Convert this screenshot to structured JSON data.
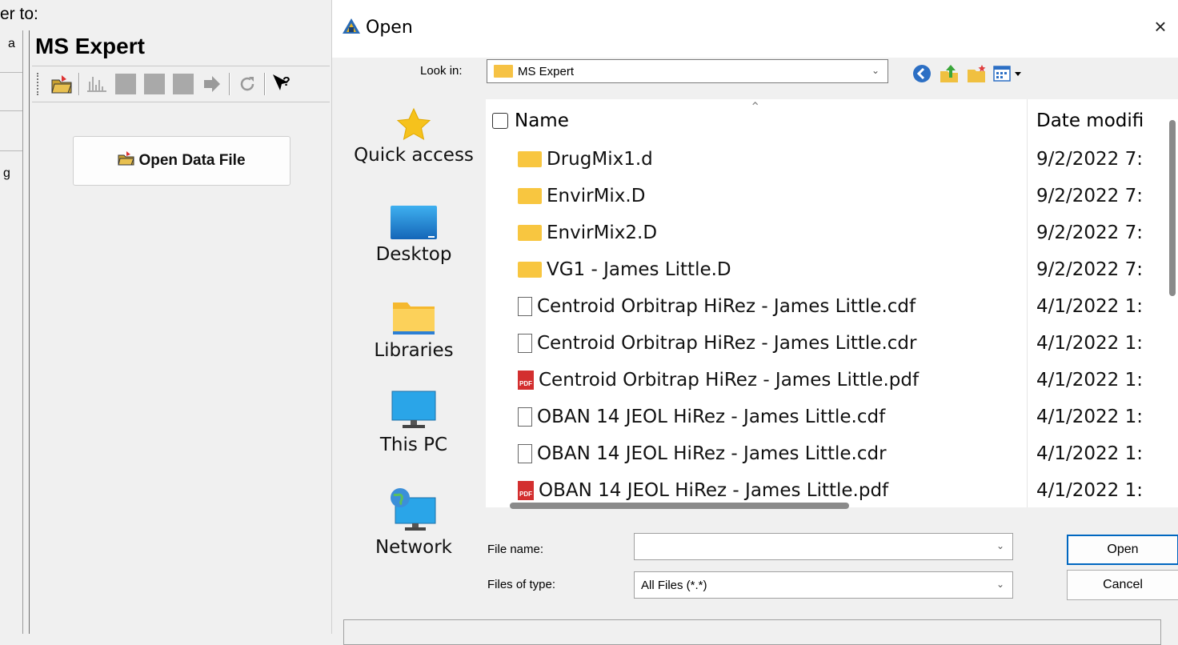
{
  "background_app": {
    "top_text": "er to:",
    "title": "MS Expert",
    "left_strip_chars": [
      "a",
      "g"
    ],
    "open_data_label": "Open Data File",
    "toolbar_icons": [
      "open-folder-icon",
      "spectrum-icon",
      "gray-square-icon",
      "gray-square-icon",
      "arrow-right-icon",
      "refresh-icon",
      "help-pointer-icon"
    ]
  },
  "dialog": {
    "title": "Open",
    "close_glyph": "×",
    "look_in_label": "Look in:",
    "look_in_value": "MS Expert",
    "nav_icons": [
      "back-icon",
      "up-folder-icon",
      "new-folder-icon",
      "view-menu-icon"
    ],
    "places": [
      {
        "label": "Quick access",
        "icon": "star-icon"
      },
      {
        "label": "Desktop",
        "icon": "desktop-icon"
      },
      {
        "label": "Libraries",
        "icon": "libraries-icon"
      },
      {
        "label": "This PC",
        "icon": "computer-icon"
      },
      {
        "label": "Network",
        "icon": "network-icon"
      }
    ],
    "columns": {
      "name": "Name",
      "date": "Date modifi"
    },
    "files": [
      {
        "name": "DrugMix1.d",
        "date": "9/2/2022 7:",
        "type": "folder"
      },
      {
        "name": "EnvirMix.D",
        "date": "9/2/2022 7:",
        "type": "folder"
      },
      {
        "name": "EnvirMix2.D",
        "date": "9/2/2022 7:",
        "type": "folder"
      },
      {
        "name": "VG1 - James Little.D",
        "date": "9/2/2022 7:",
        "type": "folder"
      },
      {
        "name": "Centroid Orbitrap HiRez - James Little.cdf",
        "date": "4/1/2022 1:",
        "type": "file"
      },
      {
        "name": "Centroid Orbitrap HiRez - James Little.cdr",
        "date": "4/1/2022 1:",
        "type": "file"
      },
      {
        "name": "Centroid Orbitrap HiRez - James Little.pdf",
        "date": "4/1/2022 1:",
        "type": "pdf"
      },
      {
        "name": "OBAN 14 JEOL HiRez - James Little.cdf",
        "date": "4/1/2022 1:",
        "type": "file"
      },
      {
        "name": "OBAN 14 JEOL HiRez - James Little.cdr",
        "date": "4/1/2022 1:",
        "type": "file"
      },
      {
        "name": "OBAN 14 JEOL HiRez - James Little.pdf",
        "date": "4/1/2022 1:",
        "type": "pdf"
      }
    ],
    "file_name_label": "File name:",
    "file_name_value": "",
    "files_of_type_label": "Files of type:",
    "files_of_type_value": "All Files (*.*)",
    "open_button": "Open",
    "cancel_button": "Cancel"
  },
  "colors": {
    "folder": "#f8c640",
    "pdf": "#d32f2f",
    "accent": "#0067c0"
  }
}
